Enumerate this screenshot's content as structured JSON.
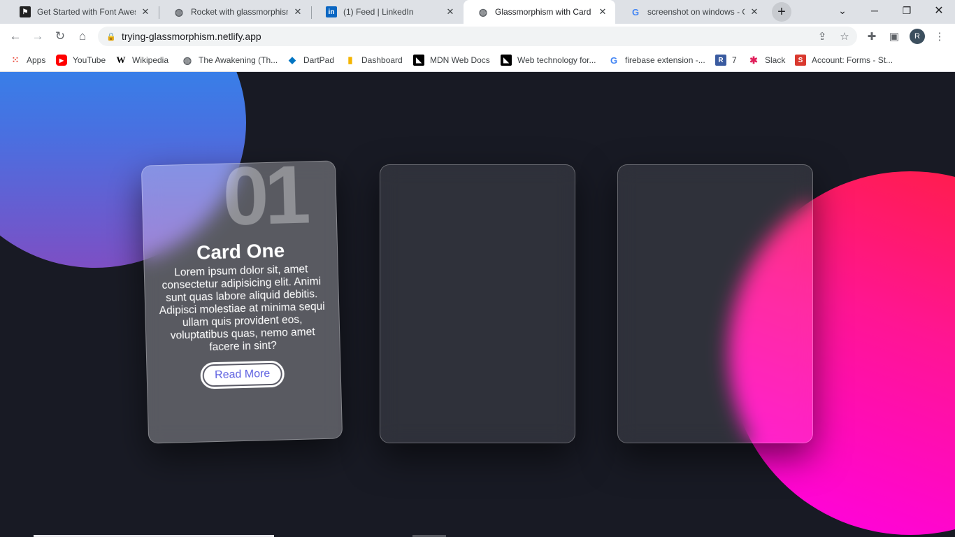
{
  "browser": {
    "tabs": [
      {
        "title": "Get Started with Font Awesome",
        "favicon": "font-awesome-flag-icon"
      },
      {
        "title": "Rocket with glassmorphism",
        "favicon": "globe-icon"
      },
      {
        "title": "(1) Feed | LinkedIn",
        "favicon": "linkedin-icon"
      },
      {
        "title": "Glassmorphism with Card",
        "favicon": "globe-icon"
      },
      {
        "title": "screenshot on windows - Google Search",
        "favicon": "google-icon"
      }
    ],
    "url": "trying-glassmorphism.netlify.app",
    "profile_initial": "R",
    "bookmarks": [
      {
        "label": "Apps"
      },
      {
        "label": "YouTube"
      },
      {
        "label": "Wikipedia"
      },
      {
        "label": "The Awakening (Th..."
      },
      {
        "label": "DartPad"
      },
      {
        "label": "Dashboard"
      },
      {
        "label": "MDN Web Docs"
      },
      {
        "label": "Web technology for..."
      },
      {
        "label": "firebase extension -..."
      },
      {
        "label": "7"
      },
      {
        "label": "Slack"
      },
      {
        "label": "Account: Forms - St..."
      }
    ]
  },
  "page": {
    "card1": {
      "number": "01",
      "title": "Card One",
      "text": "Lorem ipsum dolor sit, amet consectetur adipisicing elit. Animi sunt quas labore aliquid debitis. Adipisci molestiae at minima sequi ullam quis provident eos, voluptatibus quas, nemo amet facere in sint?",
      "button": "Read More"
    }
  },
  "colors": {
    "background": "#181a24",
    "blue_blob": "#1f94f3",
    "pink_blob": "#ff1593",
    "button_text": "#5b5ee0"
  }
}
